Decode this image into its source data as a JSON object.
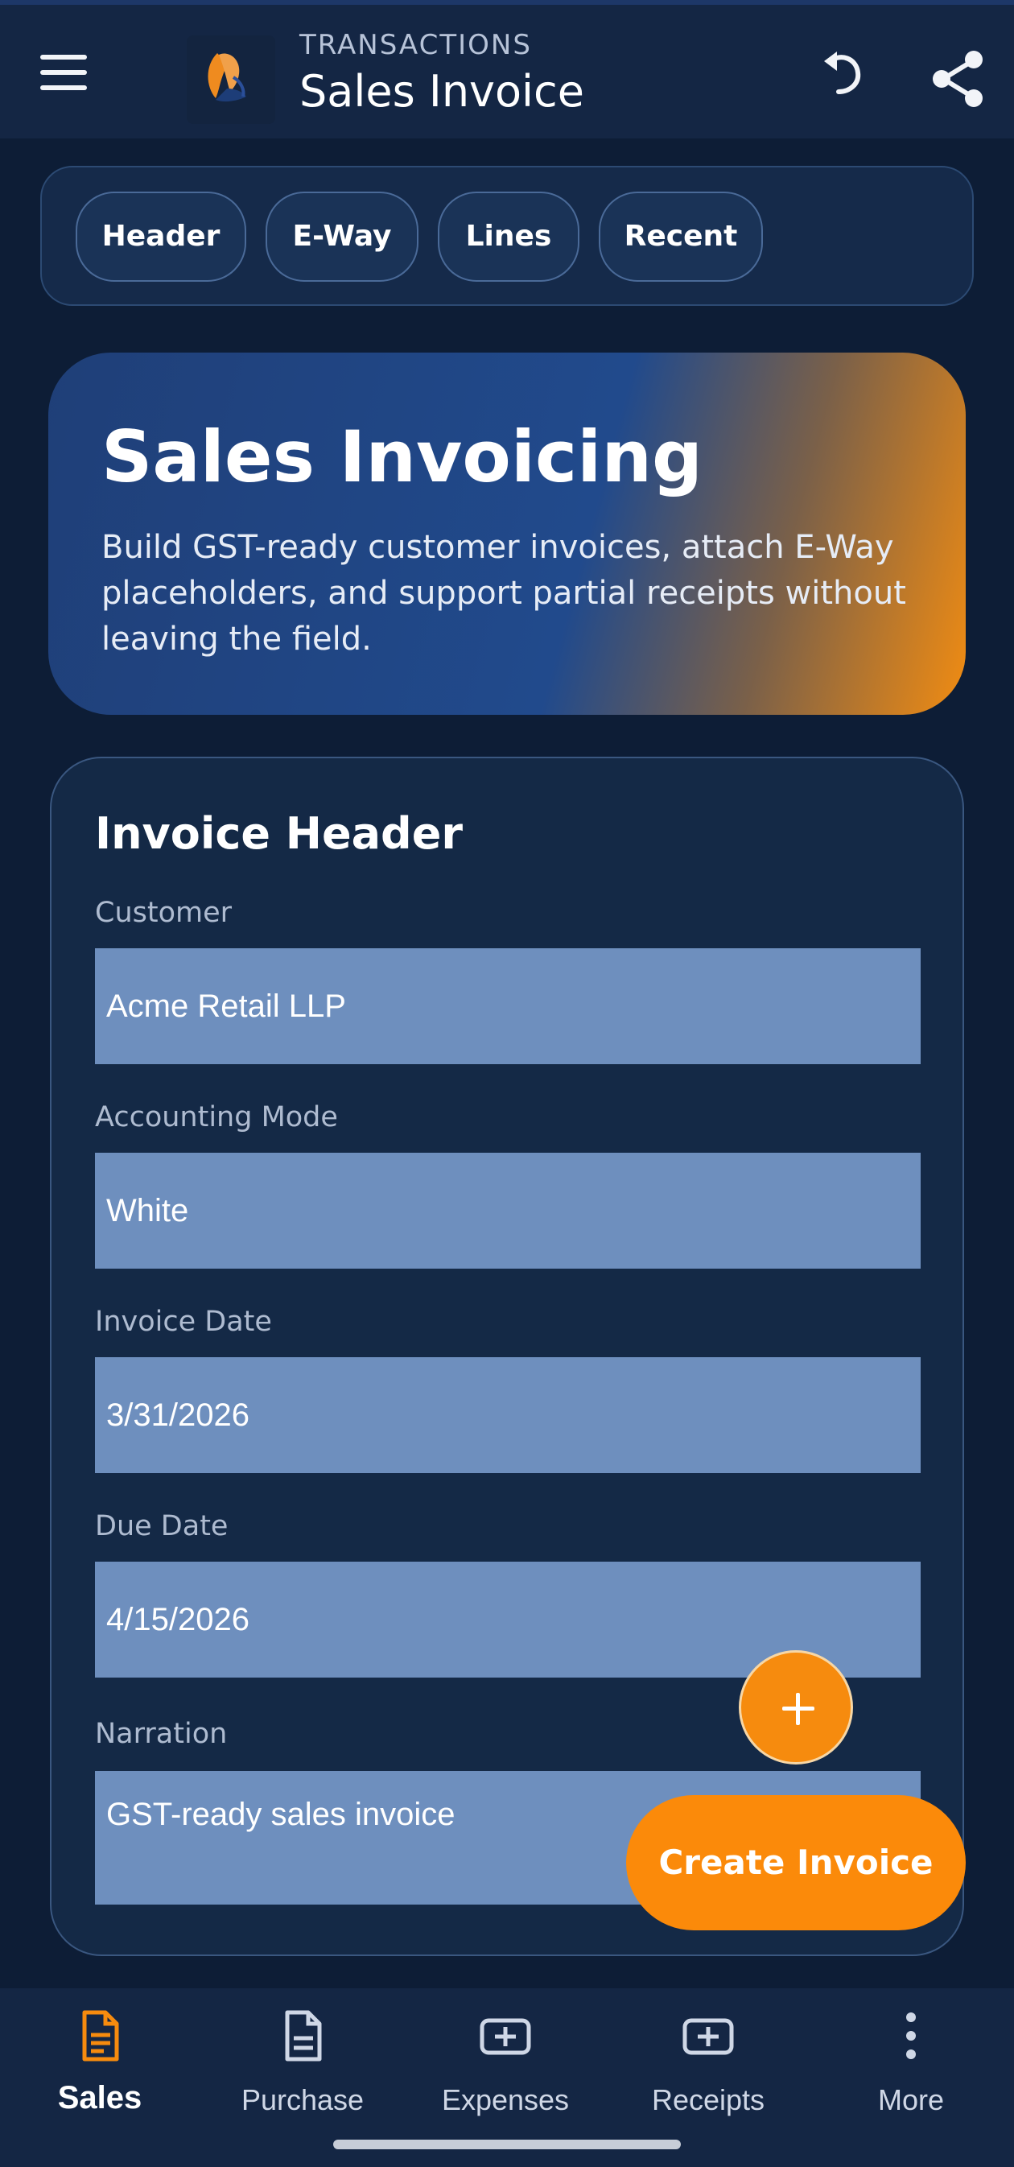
{
  "app": {
    "eyebrow": "TRANSACTIONS",
    "title": "Sales Invoice",
    "icons": {
      "menu": "menu-icon",
      "undo": "undo-icon",
      "share": "share-icon"
    }
  },
  "tabs": [
    {
      "label": "Header"
    },
    {
      "label": "E-Way"
    },
    {
      "label": "Lines"
    },
    {
      "label": "Recent"
    }
  ],
  "hero": {
    "title": "Sales Invoicing",
    "subtitle": "Build GST-ready customer invoices, attach E-Way placeholders, and support partial receipts without leaving the field."
  },
  "invoice_header": {
    "title": "Invoice Header",
    "fields": [
      {
        "label": "Customer",
        "value": "Acme Retail LLP"
      },
      {
        "label": "Accounting Mode",
        "value": "White"
      },
      {
        "label": "Invoice Date",
        "value": "3/31/2026"
      },
      {
        "label": "Due Date",
        "value": "4/15/2026"
      },
      {
        "label": "Narration",
        "value": "GST-ready sales invoice"
      }
    ]
  },
  "actions": {
    "create_label": "Create Invoice",
    "add_icon": "plus-icon"
  },
  "bottom_nav": [
    {
      "label": "Sales",
      "icon": "document-icon",
      "active": true
    },
    {
      "label": "Purchase",
      "icon": "document-icon",
      "active": false
    },
    {
      "label": "Expenses",
      "icon": "plus-box-icon",
      "active": false
    },
    {
      "label": "Receipts",
      "icon": "plus-box-icon",
      "active": false
    },
    {
      "label": "More",
      "icon": "more-vertical-icon",
      "active": false
    }
  ],
  "colors": {
    "background": "#0d1d36",
    "accent": "#fb8a0a",
    "input": "#6e8fbe"
  }
}
